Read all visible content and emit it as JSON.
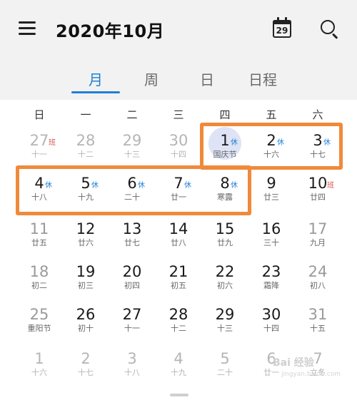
{
  "header": {
    "title": "2020年10月",
    "today_day": "29"
  },
  "tabs": [
    "月",
    "周",
    "日",
    "日程"
  ],
  "active_tab": 0,
  "weekdays": [
    "日",
    "一",
    "二",
    "三",
    "四",
    "五",
    "六"
  ],
  "weeks": [
    [
      {
        "day": "27",
        "lunar": "十一",
        "muted": true,
        "badge": "班",
        "badge_type": "work"
      },
      {
        "day": "28",
        "lunar": "十二",
        "muted": true
      },
      {
        "day": "29",
        "lunar": "十三",
        "muted": true
      },
      {
        "day": "30",
        "lunar": "十四",
        "muted": true
      },
      {
        "day": "1",
        "lunar": "国庆节",
        "badge": "休",
        "badge_type": "rest",
        "today": true
      },
      {
        "day": "2",
        "lunar": "十六",
        "badge": "休",
        "badge_type": "rest"
      },
      {
        "day": "3",
        "lunar": "十七",
        "badge": "休",
        "badge_type": "rest"
      }
    ],
    [
      {
        "day": "4",
        "lunar": "十八",
        "badge": "休",
        "badge_type": "rest"
      },
      {
        "day": "5",
        "lunar": "十九",
        "badge": "休",
        "badge_type": "rest"
      },
      {
        "day": "6",
        "lunar": "二十",
        "badge": "休",
        "badge_type": "rest"
      },
      {
        "day": "7",
        "lunar": "廿一",
        "badge": "休",
        "badge_type": "rest"
      },
      {
        "day": "8",
        "lunar": "寒露",
        "badge": "休",
        "badge_type": "rest"
      },
      {
        "day": "9",
        "lunar": "廿三"
      },
      {
        "day": "10",
        "lunar": "廿四",
        "badge": "班",
        "badge_type": "work"
      }
    ],
    [
      {
        "day": "11",
        "lunar": "廿五",
        "weekend": true
      },
      {
        "day": "12",
        "lunar": "廿六"
      },
      {
        "day": "13",
        "lunar": "廿七"
      },
      {
        "day": "14",
        "lunar": "廿八"
      },
      {
        "day": "15",
        "lunar": "廿九"
      },
      {
        "day": "16",
        "lunar": "三十"
      },
      {
        "day": "17",
        "lunar": "九月",
        "weekend": true
      }
    ],
    [
      {
        "day": "18",
        "lunar": "初二",
        "weekend": true
      },
      {
        "day": "19",
        "lunar": "初三"
      },
      {
        "day": "20",
        "lunar": "初四"
      },
      {
        "day": "21",
        "lunar": "初五"
      },
      {
        "day": "22",
        "lunar": "初六"
      },
      {
        "day": "23",
        "lunar": "霜降"
      },
      {
        "day": "24",
        "lunar": "初八",
        "weekend": true
      }
    ],
    [
      {
        "day": "25",
        "lunar": "重阳节",
        "weekend": true
      },
      {
        "day": "26",
        "lunar": "初十"
      },
      {
        "day": "27",
        "lunar": "十一"
      },
      {
        "day": "28",
        "lunar": "十二"
      },
      {
        "day": "29",
        "lunar": "十三"
      },
      {
        "day": "30",
        "lunar": "十四"
      },
      {
        "day": "31",
        "lunar": "十五",
        "weekend": true
      }
    ],
    [
      {
        "day": "1",
        "lunar": "十六",
        "muted": true
      },
      {
        "day": "2",
        "lunar": "十七",
        "muted": true
      },
      {
        "day": "3",
        "lunar": "十八",
        "muted": true
      },
      {
        "day": "4",
        "lunar": "十九",
        "muted": true
      },
      {
        "day": "5",
        "lunar": "二十",
        "muted": true
      },
      {
        "day": "6",
        "lunar": "廿一",
        "muted": true
      },
      {
        "day": "7",
        "lunar": "立冬",
        "muted": true
      }
    ]
  ],
  "colors": {
    "accent": "#1f7fd6",
    "highlight": "#f08a3a",
    "rest_badge": "#1f7fd6",
    "work_badge": "#d9534f",
    "today_circle": "#dfe3f6"
  },
  "watermark": {
    "text": "Bai 经验",
    "sub": "jingyan.baidu.com"
  }
}
